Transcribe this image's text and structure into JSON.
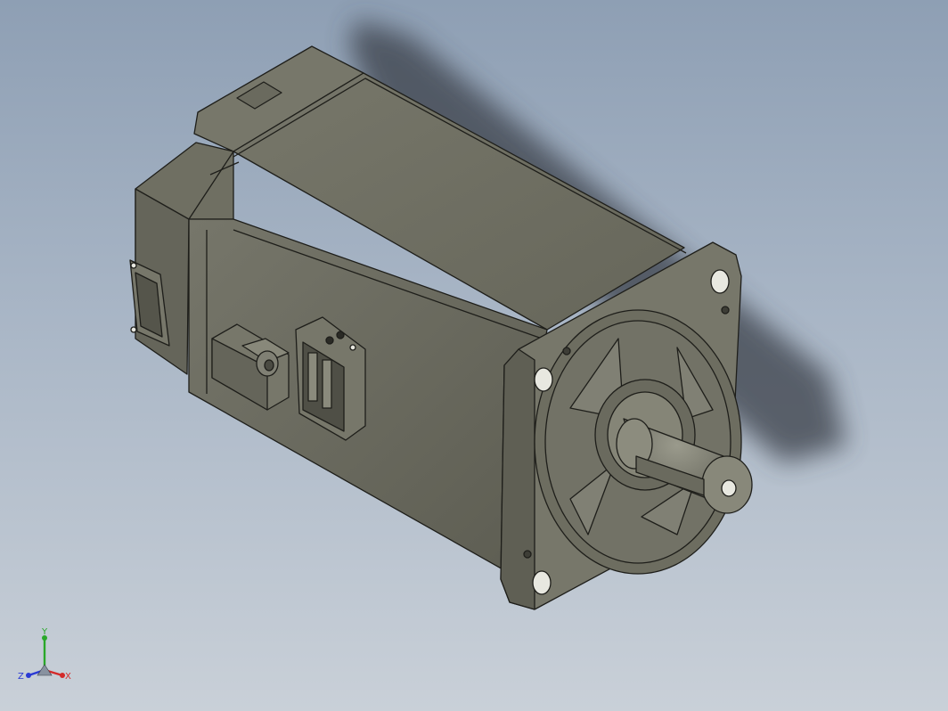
{
  "viewport": {
    "background_top": "#8e9fb4",
    "background_bottom": "#c9d0d8",
    "model_body_color": "#6b6b5e",
    "model_edge_color": "#1e1e1a"
  },
  "triad": {
    "x_label": "X",
    "y_label": "Y",
    "z_label": "Z",
    "x_color": "#d42a2a",
    "y_color": "#2aa82a",
    "z_color": "#2a3ad4"
  }
}
